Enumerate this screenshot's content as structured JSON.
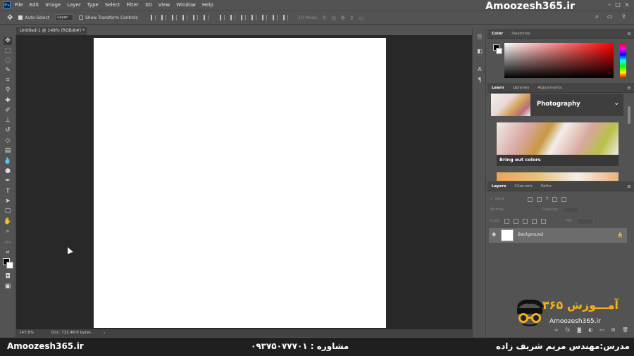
{
  "app": {
    "menu": [
      "File",
      "Edit",
      "Image",
      "Layer",
      "Type",
      "Select",
      "Filter",
      "3D",
      "View",
      "Window",
      "Help"
    ],
    "brand_top": "Amoozesh365.ir"
  },
  "options_bar": {
    "auto_select_label": "Auto-Select",
    "auto_select_checked": true,
    "target_select": "Layer",
    "transform_controls_label": "Show Transform Controls",
    "mode_label": "3D Mode:"
  },
  "document": {
    "tab_title": "Untitled-1 @ 148% (RGB/8#) *",
    "zoom": "147.8%",
    "doc_info": "Doc: 732.4K/0 bytes"
  },
  "color_panel": {
    "tabs": [
      "Color",
      "Swatches"
    ],
    "foreground": "#000000",
    "background": "#ffffff",
    "hue_color": "#ff0000"
  },
  "learn_panel": {
    "tabs": [
      "Learn",
      "Libraries",
      "Adjustments"
    ],
    "topic": "Photography",
    "card_title": "Bring out colors"
  },
  "layers_panel": {
    "tabs": [
      "Layers",
      "Channels",
      "Paths"
    ],
    "filter_placeholder": "Kind",
    "blend_mode": "Normal",
    "opacity_label": "Opacity:",
    "lock_label": "Lock:",
    "fill_label": "Fill:",
    "layers": [
      {
        "name": "Background",
        "visible": true,
        "locked": true
      }
    ]
  },
  "logo": {
    "persian": "آمـــوزش ۳۶۵",
    "domain": "Amoozesh365.ir"
  },
  "footer": {
    "left": "Amoozesh365.ir",
    "middle": "مشاوره : ۰۹۳۷۵۰۷۷۷۰۱",
    "right": "مدرس:مهندس مریم شریف زاده"
  }
}
